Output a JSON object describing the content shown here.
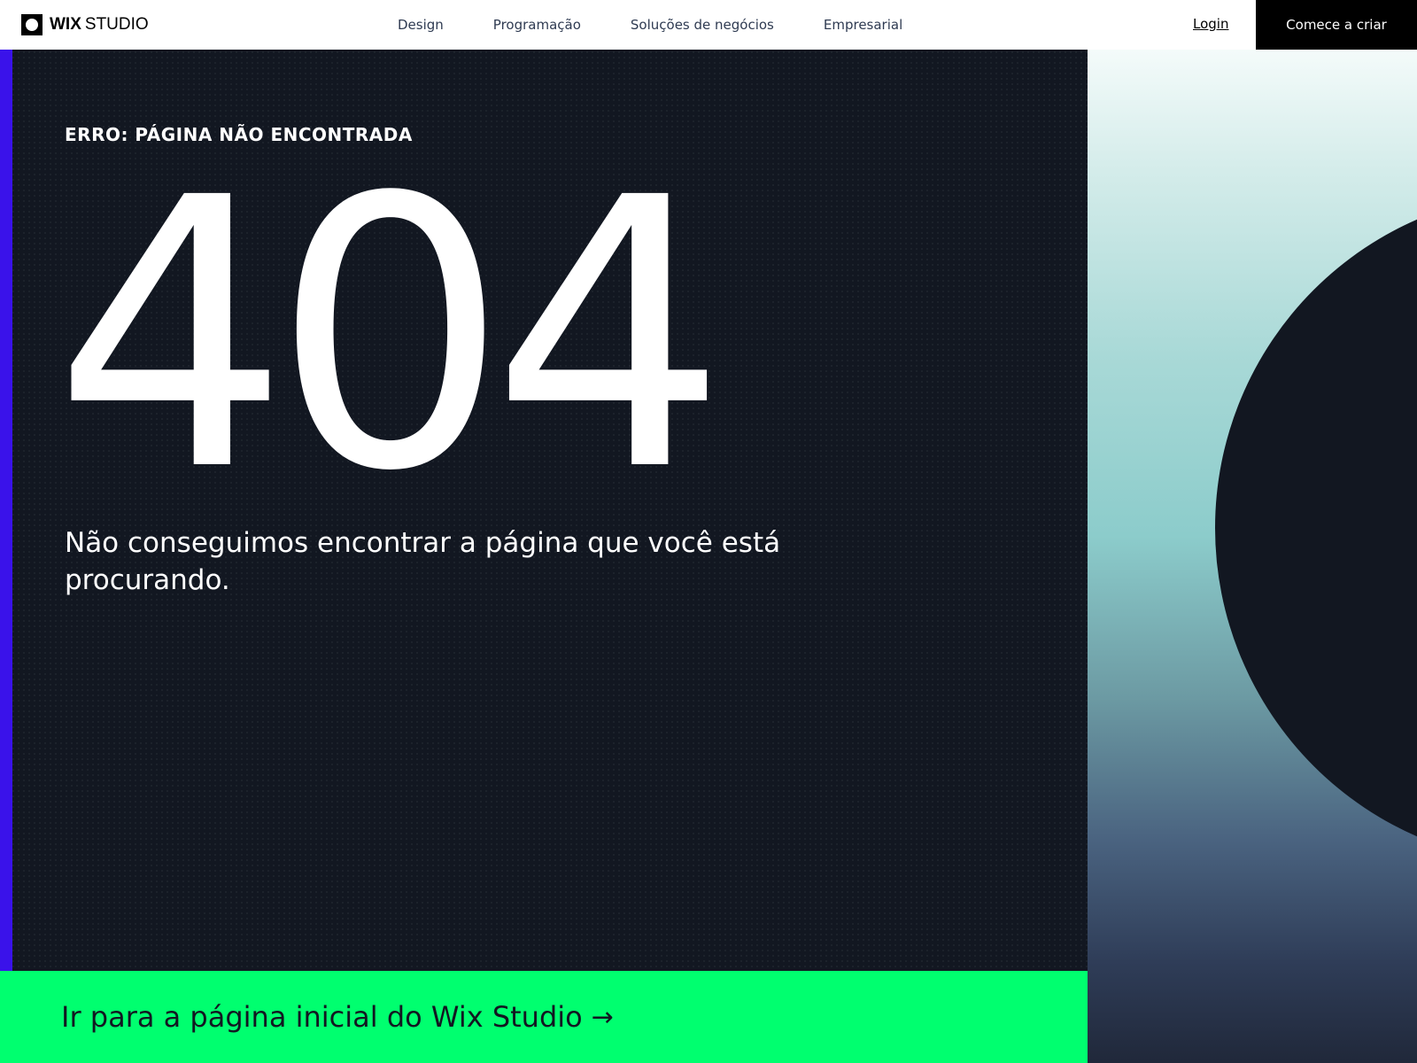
{
  "header": {
    "logo_wix": "WIX",
    "logo_studio": "STUDIO",
    "nav": [
      {
        "label": "Design"
      },
      {
        "label": "Programação"
      },
      {
        "label": "Soluções de negócios"
      },
      {
        "label": "Empresarial"
      }
    ],
    "login_label": "Login",
    "cta_label": "Comece a criar"
  },
  "main": {
    "error_label": "ERRO: PÁGINA NÃO ENCONTRADA",
    "error_code": "404",
    "message": "Não conseguimos encontrar a página que você está procurando.",
    "home_link_label": "Ir para a página inicial do Wix Studio",
    "home_link_arrow": "→"
  },
  "colors": {
    "accent_bar": "#3a12ea",
    "cta_green": "#00ff6f",
    "panel_dark": "#121721"
  }
}
